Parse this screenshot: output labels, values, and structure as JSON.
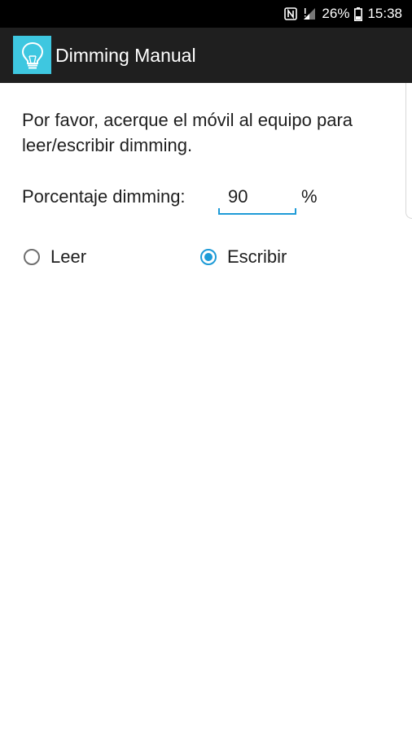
{
  "status_bar": {
    "battery_percent": "26%",
    "time": "15:38",
    "icons": [
      "nfc-icon",
      "signal-icon",
      "battery-icon"
    ]
  },
  "app_bar": {
    "title": "Dimming Manual",
    "icon": "lightbulb-icon",
    "icon_bg_color": "#3ec7e0"
  },
  "main": {
    "message": "Por favor, acerque el móvil al equipo para leer/escribir dimming.",
    "dimming_label": "Porcentaje dimming:",
    "dimming_value": "90",
    "percent_sign": "%",
    "accent_color": "#1e9bd7",
    "radio_options": [
      {
        "label": "Leer",
        "checked": false
      },
      {
        "label": "Escribir",
        "checked": true
      }
    ]
  }
}
